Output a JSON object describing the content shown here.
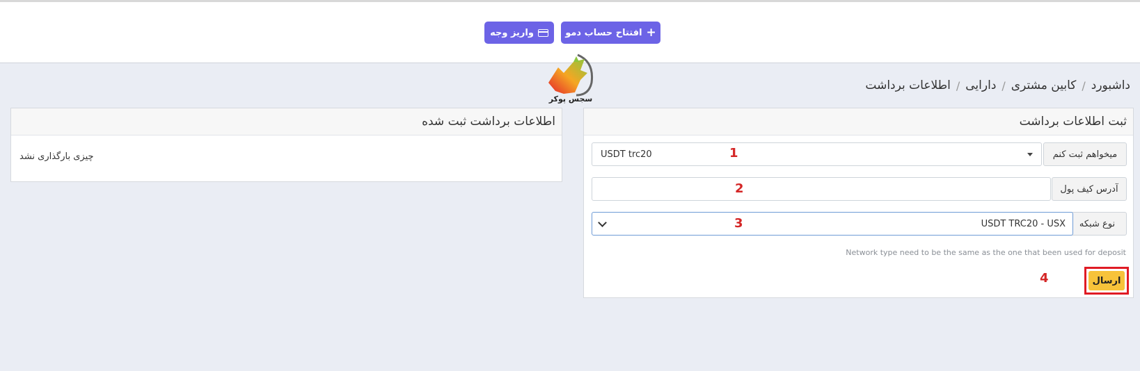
{
  "header": {
    "demo_button": "افتتاح حساب دمو",
    "deposit_button": "واریز وجه",
    "logo_text": "سجس پوکر"
  },
  "breadcrumb": [
    "داشبورد",
    "کابین مشتری",
    "دارایی",
    "اطلاعات برداشت"
  ],
  "registered_panel": {
    "title": "اطلاعات برداشت ثبت شده",
    "empty_message": "چیزی بارگذاری نشد"
  },
  "form_panel": {
    "title": "ثبت اطلاعات برداشت",
    "register_label": "میخواهم ثبت کنم",
    "register_value": "USDT trc20",
    "wallet_label": "آدرس کیف پول",
    "wallet_value": "",
    "network_label": "نوع شبکه",
    "network_value": "USDT TRC20 - USX",
    "hint": "Network type need to be the same as the one that been used for deposit",
    "submit_label": "ارسال"
  },
  "annotations": [
    "1",
    "2",
    "3",
    "4"
  ],
  "colors": {
    "primary": "#6c63e6",
    "submit": "#f7c33a",
    "highlight": "#e01b24",
    "annotation": "#d42626"
  }
}
